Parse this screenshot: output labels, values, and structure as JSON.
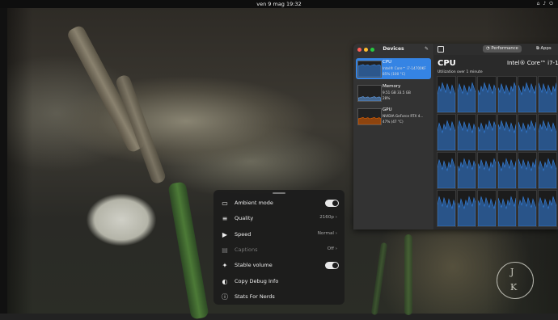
{
  "topbar": {
    "clock": "ven 9 mag  19:32",
    "tray_icons": [
      "network-icon",
      "volume-icon",
      "power-icon"
    ]
  },
  "resources": {
    "sidebar_title": "Devices",
    "devices": [
      {
        "name": "CPU",
        "line1": "Intel® Core™ i7-14700KF",
        "line2": "85% (100 °C)",
        "active": true,
        "graph_color": "#3584e4",
        "level": 0.85
      },
      {
        "name": "Memory",
        "line1": "9.51 GB  33.5 GB",
        "line2": "28%",
        "active": false,
        "graph_color": "#62a0ea",
        "level": 0.28
      },
      {
        "name": "GPU",
        "line1": "NVIDIA GeForce RTX 4...",
        "line2": "47% (47 °C)",
        "active": false,
        "graph_color": "#e66100",
        "level": 0.47
      }
    ],
    "tabs": [
      {
        "label": "Performance",
        "icon": "gauge-icon",
        "active": true
      },
      {
        "label": "Apps",
        "icon": "apps-icon",
        "active": false
      }
    ],
    "main_title": "CPU",
    "cpu_model": "Intel® Core™ i7-14",
    "utilization_label": "Utilization over 1 minute",
    "core_count": 24,
    "accent": "#3584e4"
  },
  "video_menu": {
    "items": [
      {
        "icon": "ambient-mode-icon",
        "glyph": "▭",
        "label": "Ambient mode",
        "value": "",
        "toggle": true,
        "disabled": false
      },
      {
        "icon": "quality-icon",
        "glyph": "≡",
        "label": "Quality",
        "value": "2160p ›",
        "toggle": false,
        "disabled": false
      },
      {
        "icon": "speed-icon",
        "glyph": "▶",
        "label": "Speed",
        "value": "Normal ›",
        "toggle": false,
        "disabled": false
      },
      {
        "icon": "captions-icon",
        "glyph": "▤",
        "label": "Captions",
        "value": "Off ›",
        "toggle": false,
        "disabled": true
      },
      {
        "icon": "stable-volume-icon",
        "glyph": "✦",
        "label": "Stable volume",
        "value": "",
        "toggle": true,
        "disabled": false
      },
      {
        "icon": "debug-info-icon",
        "glyph": "◐",
        "label": "Copy Debug Info",
        "value": "",
        "toggle": false,
        "disabled": false
      },
      {
        "icon": "stats-icon",
        "glyph": "ⓘ",
        "label": "Stats For Nerds",
        "value": "",
        "toggle": false,
        "disabled": false
      }
    ]
  },
  "watermark": {
    "letters": [
      "J",
      "K"
    ]
  }
}
